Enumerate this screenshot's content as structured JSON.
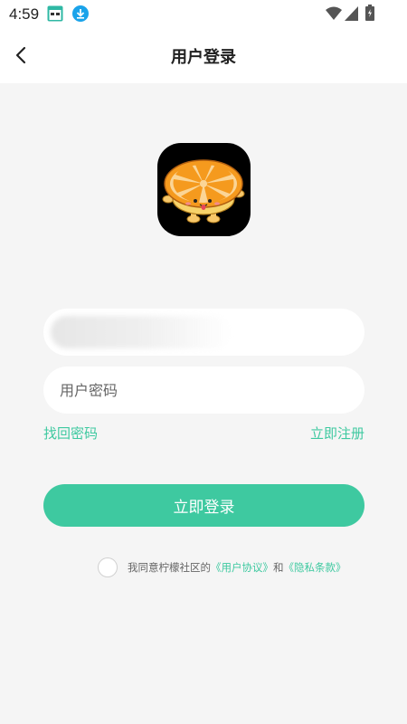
{
  "status_bar": {
    "time": "4:59",
    "icons": [
      "app-notification-icon",
      "download-icon",
      "wifi-icon",
      "signal-icon",
      "battery-icon"
    ]
  },
  "header": {
    "title": "用户登录",
    "back_icon": "chevron-left-icon"
  },
  "logo": {
    "icon": "orange-mascot-logo"
  },
  "form": {
    "account_placeholder": "",
    "password_placeholder": "用户密码",
    "forgot_password": "找回密码",
    "register": "立即注册",
    "login_button": "立即登录"
  },
  "agreement": {
    "prefix": "我同意柠檬社区的",
    "user_agreement": "《用户协议》",
    "and": "和",
    "privacy_policy": "《隐私条款》"
  },
  "colors": {
    "accent": "#3ec9a0",
    "background": "#f5f5f5",
    "card": "#ffffff"
  }
}
